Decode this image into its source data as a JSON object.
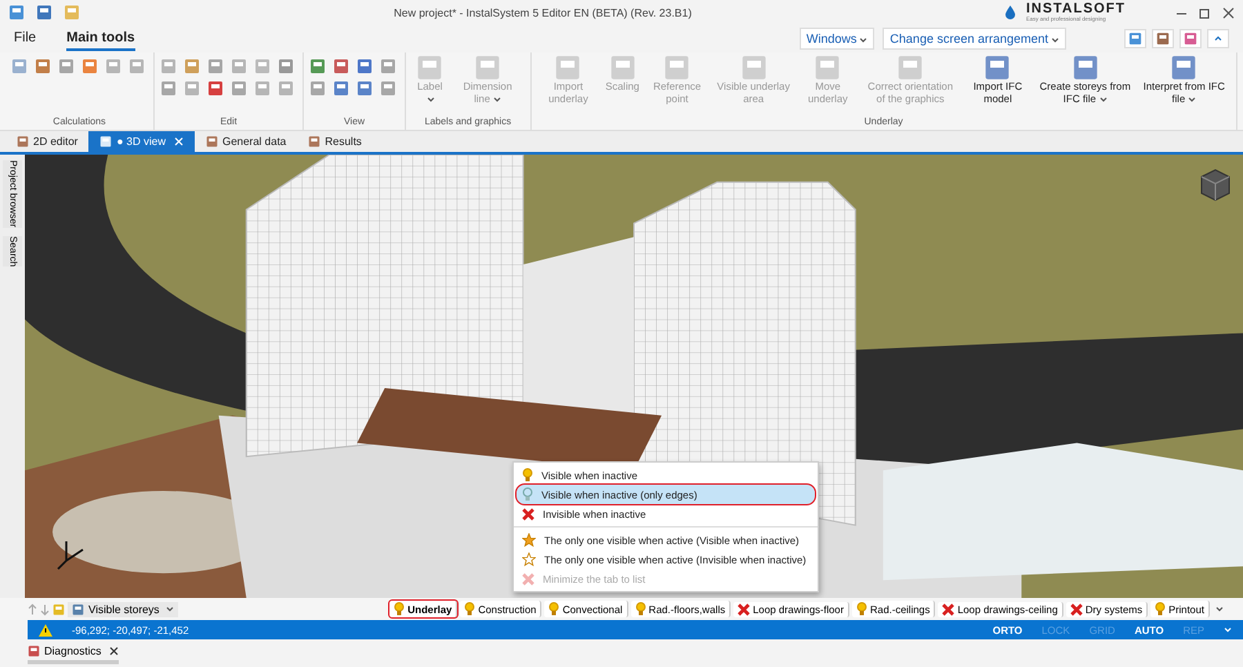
{
  "window": {
    "title": "New project* - InstalSystem 5 Editor EN (BETA) (Rev. 23.B1)",
    "logo": "INSTALSOFT",
    "logo_tagline": "Easy and professional designing"
  },
  "menu_tabs": [
    {
      "label": "File",
      "selected": false
    },
    {
      "label": "Main tools",
      "selected": true
    }
  ],
  "header_dropdowns": [
    "Windows",
    "Change screen arrangement"
  ],
  "ribbon_groups": [
    {
      "title": "Calculations",
      "kind": "icons"
    },
    {
      "title": "Edit",
      "kind": "icons"
    },
    {
      "title": "View",
      "kind": "icons"
    },
    {
      "title": "Labels and graphics",
      "kind": "buttons",
      "buttons": [
        {
          "label": "Label",
          "disabled": true,
          "dropdown": true
        },
        {
          "label": "Dimension line",
          "disabled": true,
          "dropdown": true
        }
      ]
    },
    {
      "title": "Underlay",
      "kind": "buttons",
      "buttons": [
        {
          "label": "Import underlay",
          "disabled": true,
          "dropdown": false
        },
        {
          "label": "Scaling",
          "disabled": true,
          "dropdown": false
        },
        {
          "label": "Reference point",
          "disabled": true,
          "dropdown": false
        },
        {
          "label": "Visible underlay area",
          "disabled": true,
          "dropdown": false
        },
        {
          "label": "Move underlay",
          "disabled": true,
          "dropdown": false
        },
        {
          "label": "Correct orientation of the graphics",
          "disabled": true,
          "dropdown": false
        },
        {
          "label": "Import IFC model",
          "disabled": false,
          "dropdown": false
        },
        {
          "label": "Create storeys from IFC file",
          "disabled": false,
          "dropdown": true
        },
        {
          "label": "Interpret from IFC file",
          "disabled": false,
          "dropdown": true
        }
      ]
    }
  ],
  "doc_tabs": [
    {
      "label": "2D editor",
      "selected": false,
      "closable": false
    },
    {
      "label": "● 3D view",
      "selected": true,
      "closable": true
    },
    {
      "label": "General data",
      "selected": false,
      "closable": false
    },
    {
      "label": "Results",
      "selected": false,
      "closable": false
    }
  ],
  "side_tabs": [
    "Project browser",
    "Search"
  ],
  "context_menu": [
    {
      "label": "Visible when inactive",
      "kind": "bulb",
      "selected": false,
      "disabled": false
    },
    {
      "label": "Visible when inactive (only edges)",
      "kind": "outline",
      "selected": true,
      "disabled": false
    },
    {
      "label": "Invisible when inactive",
      "kind": "cross",
      "selected": false,
      "disabled": false
    },
    {
      "label": "The only one visible when active (Visible when inactive)",
      "kind": "star",
      "selected": false,
      "disabled": false
    },
    {
      "label": "The only one visible when active (Invisible when inactive)",
      "kind": "hollowstar",
      "selected": false,
      "disabled": false
    },
    {
      "label": "Minimize the tab to list",
      "kind": "cross",
      "selected": false,
      "disabled": true
    }
  ],
  "storeys_dropdown": "Visible storeys",
  "layer_tabs": [
    {
      "label": "Underlay",
      "kind": "bulb",
      "selected": true
    },
    {
      "label": "Construction",
      "kind": "bulb",
      "selected": false
    },
    {
      "label": "Convectional",
      "kind": "bulb",
      "selected": false
    },
    {
      "label": "Rad.-floors,walls",
      "kind": "bulb",
      "selected": false
    },
    {
      "label": "Loop drawings-floor",
      "kind": "cross",
      "selected": false
    },
    {
      "label": "Rad.-ceilings",
      "kind": "bulb",
      "selected": false
    },
    {
      "label": "Loop drawings-ceiling",
      "kind": "cross",
      "selected": false
    },
    {
      "label": "Dry systems",
      "kind": "cross",
      "selected": false
    },
    {
      "label": "Printout",
      "kind": "bulb",
      "selected": false
    }
  ],
  "status_bar": {
    "coordinates": "-96,292; -20,497; -21,452",
    "toggles": [
      {
        "label": "ORTO",
        "on": true
      },
      {
        "label": "LOCK",
        "on": false
      },
      {
        "label": "GRID",
        "on": false
      },
      {
        "label": "AUTO",
        "on": true
      },
      {
        "label": "REP",
        "on": false
      }
    ]
  },
  "bottom_panel": {
    "label": "Diagnostics"
  }
}
